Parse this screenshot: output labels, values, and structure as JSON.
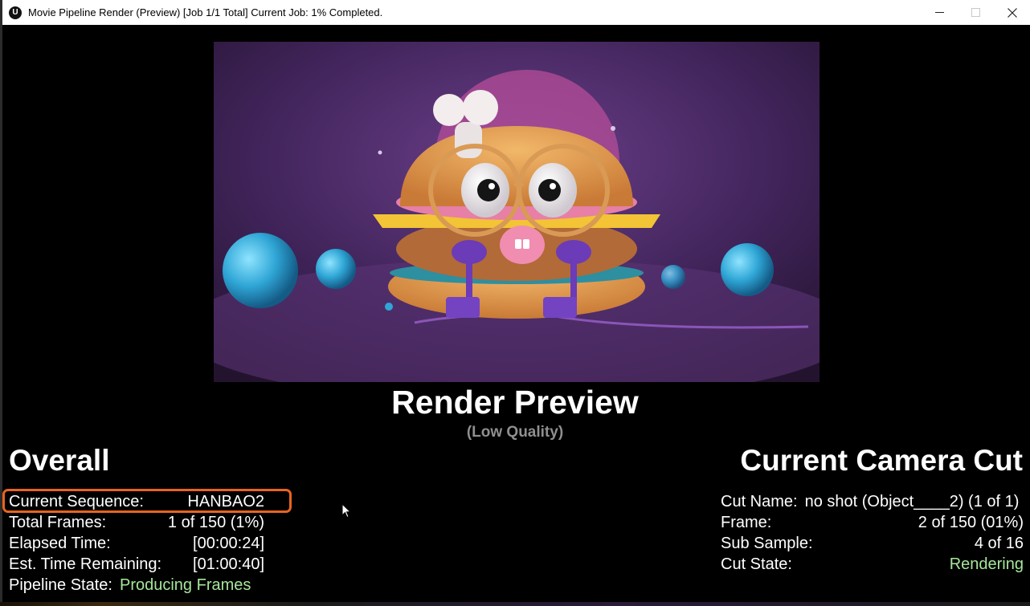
{
  "window": {
    "title": "Movie Pipeline Render (Preview) [Job 1/1 Total] Current Job: 1% Completed.",
    "logo_text": "U",
    "controls": [
      "minimize",
      "maximize",
      "close"
    ]
  },
  "preview": {
    "title": "Render Preview",
    "subtitle": "(Low Quality)"
  },
  "overall": {
    "title": "Overall",
    "rows": [
      {
        "label": "Current Sequence:",
        "value": "HANBAO2"
      },
      {
        "label": "Total Frames:",
        "value": "1 of 150 (1%)"
      },
      {
        "label": "Elapsed Time:",
        "value": "[00:00:24]"
      },
      {
        "label": "Est. Time Remaining:",
        "value": "[01:00:40]"
      },
      {
        "label": "Pipeline State:",
        "value": "Producing Frames"
      }
    ]
  },
  "camera_cut": {
    "title": "Current Camera Cut",
    "rows": [
      {
        "label": "Cut Name:",
        "value": "no shot (Object____2) (1 of 1)"
      },
      {
        "label": "Frame:",
        "value": "2 of 150 (01%)"
      },
      {
        "label": "Sub Sample:",
        "value": "4 of 16"
      },
      {
        "label": "Cut State:",
        "value": "Rendering"
      }
    ]
  },
  "colors": {
    "state_green": "#a6e69a",
    "highlight_orange": "#e8641f",
    "background": "#000000"
  }
}
